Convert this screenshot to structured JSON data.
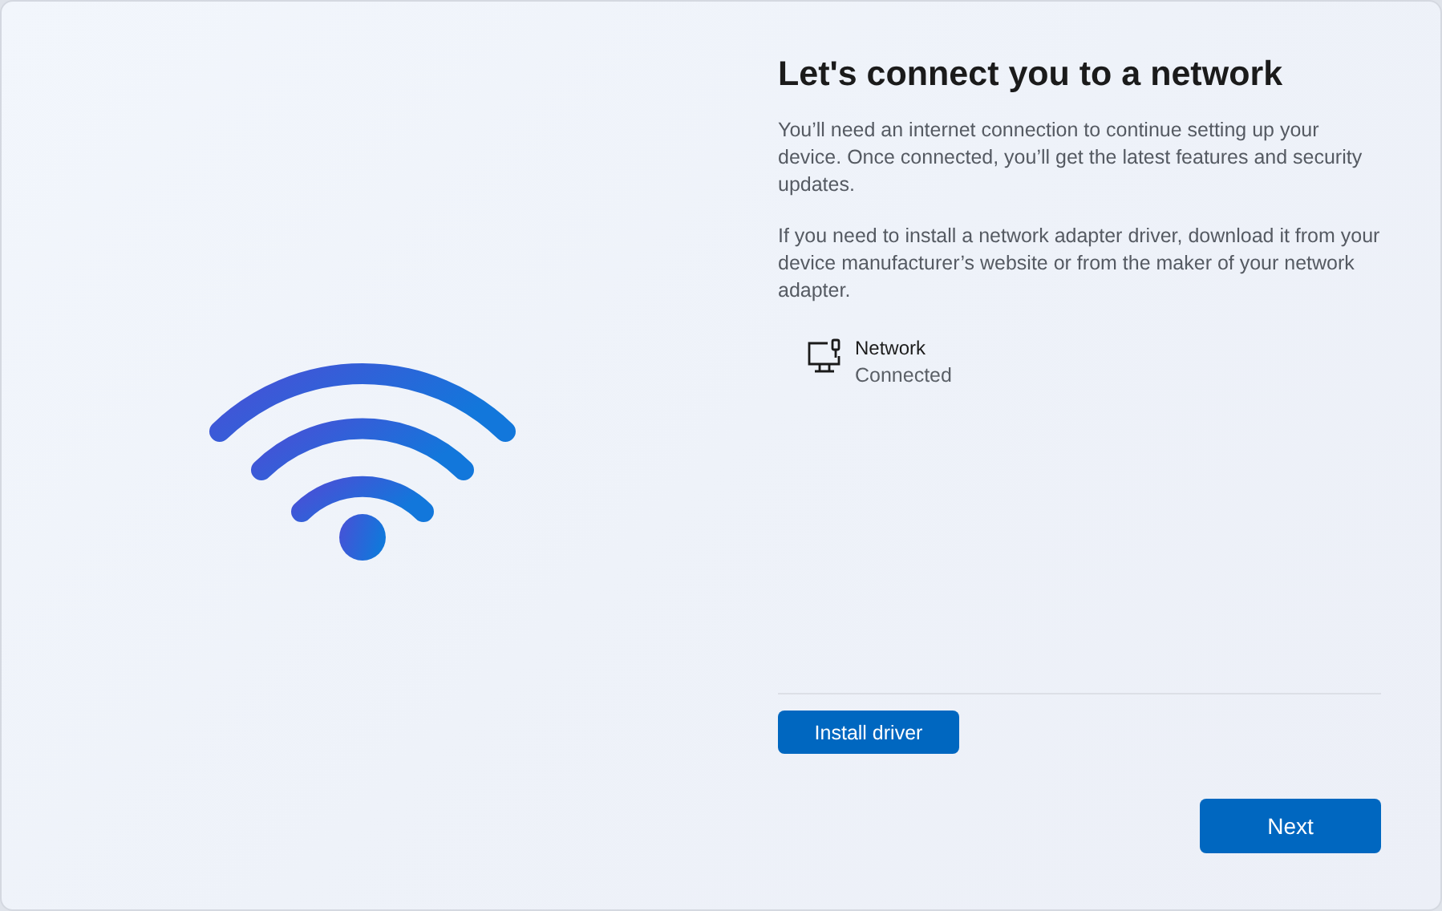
{
  "title": "Let's connect you to a network",
  "paragraphs": [
    "You’ll need an internet connection to continue setting up your device. Once connected, you’ll get the latest features and security updates.",
    "If you need to install a network adapter driver, download it from your device manufacturer’s website or from the maker of your network adapter."
  ],
  "network": {
    "name": "Network",
    "status": "Connected"
  },
  "buttons": [
    {
      "label": "Install driver",
      "kind": "secondary"
    },
    {
      "label": "Next",
      "kind": "primary"
    }
  ]
}
